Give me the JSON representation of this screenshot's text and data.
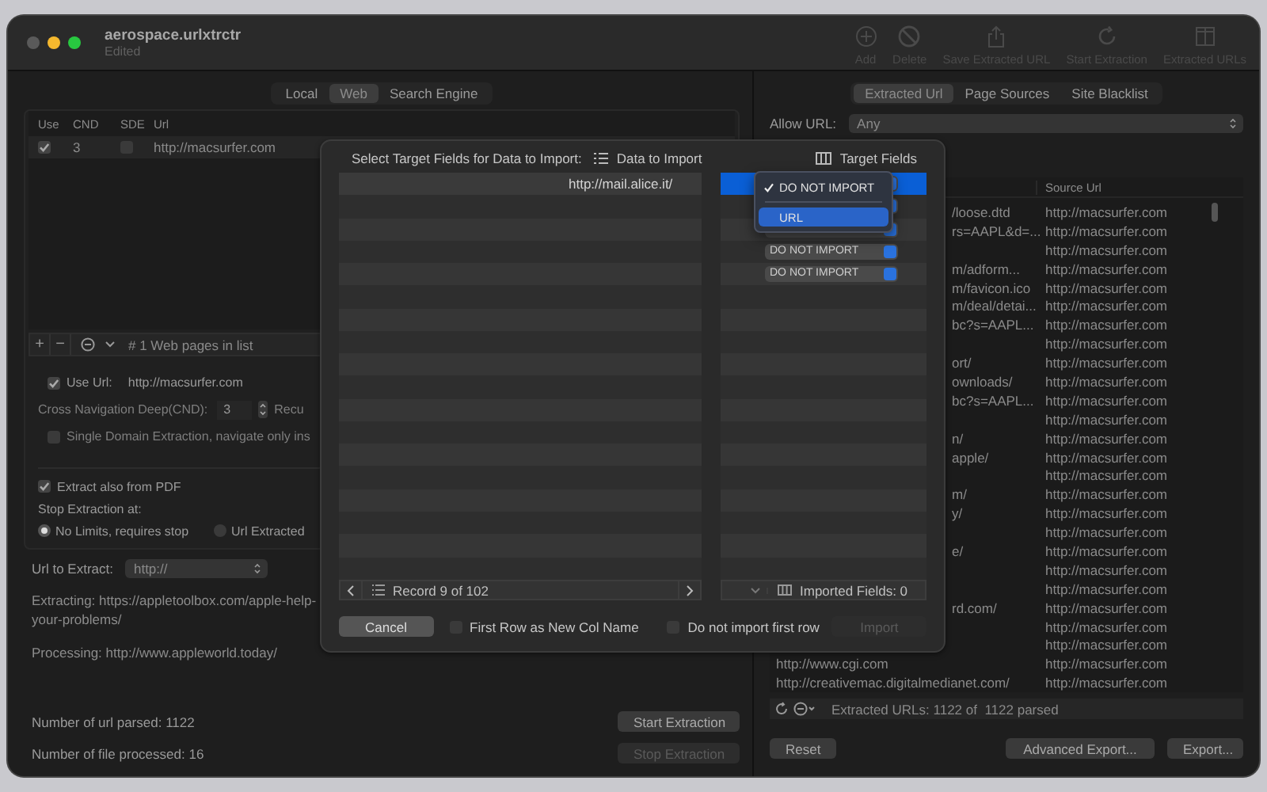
{
  "window": {
    "title": "aerospace.urlxtrctr",
    "subtitle": "Edited"
  },
  "toolbar": [
    {
      "label": "Add",
      "kind": "add",
      "disabled": true
    },
    {
      "label": "Delete",
      "kind": "delete",
      "disabled": true
    },
    {
      "label": "Save Extracted URL",
      "kind": "share",
      "disabled": true
    },
    {
      "label": "Start Extraction",
      "kind": "refresh",
      "disabled": true
    },
    {
      "label": "Extracted URLs",
      "kind": "columns",
      "disabled": true
    }
  ],
  "left_tabs": [
    {
      "label": "Local",
      "selected": false
    },
    {
      "label": "Web",
      "selected": true
    },
    {
      "label": "Search Engine",
      "selected": false
    }
  ],
  "web_table": {
    "columns": [
      "Use",
      "CND",
      "SDE",
      "Url"
    ],
    "rows": [
      {
        "use": true,
        "cnd": "3",
        "sde": false,
        "url": "http://macsurfer.com"
      }
    ]
  },
  "list_bar": {
    "add": "+",
    "remove": "−",
    "count": "# 1 Web pages in list"
  },
  "use_url": {
    "checked": true,
    "label": "Use Url:",
    "value": "http://macsurfer.com"
  },
  "cnd": {
    "label": "Cross Navigation Deep(CND):",
    "value": "3",
    "after": "Recu"
  },
  "single_domain": {
    "checked": false,
    "label": "Single Domain Extraction, navigate only ins"
  },
  "extract_pdf": {
    "checked": true,
    "label": "Extract also from PDF"
  },
  "stop_label": "Stop Extraction at:",
  "stop_options": [
    {
      "label": "No Limits, requires stop",
      "selected": true
    },
    {
      "label": "Url Extracted",
      "selected": false
    }
  ],
  "url_to_extract": {
    "label": "Url to Extract:",
    "value": "http://"
  },
  "extracting": [
    "Extracting: https://appletoolbox.com/apple-help-",
    "your-problems/"
  ],
  "processing": "Processing: http://www.appleworld.today/",
  "url_parsed": "Number of url parsed: 1122",
  "files_processed": "Number of file processed: 16",
  "extraction_buttons": [
    {
      "label": "Start Extraction",
      "disabled": false
    },
    {
      "label": "Stop Extraction",
      "disabled": true
    }
  ],
  "right_tabs": [
    {
      "label": "Extracted Url",
      "selected": true
    },
    {
      "label": "Page Sources",
      "selected": false
    },
    {
      "label": "Site Blacklist",
      "selected": false
    }
  ],
  "allow_url": {
    "label": "Allow URL:",
    "value": "Any"
  },
  "url_table": {
    "source_header": "Source Url",
    "rows_under_sheet": [
      {
        "column_1": "/loose.dtd",
        "source": "http://macsurfer.com"
      },
      {
        "column_1": "rs=AAPL&d=...",
        "source": "http://macsurfer.com"
      },
      {
        "source": "http://macsurfer.com"
      },
      {
        "column_1": "m/adform...",
        "source": "http://macsurfer.com"
      },
      {
        "column_1": "m/favicon.ico",
        "source": "http://macsurfer.com"
      },
      {
        "column_1": "m/deal/detai...",
        "source": "http://macsurfer.com"
      },
      {
        "column_1": "bc?s=AAPL...",
        "source": "http://macsurfer.com"
      },
      {
        "source": "http://macsurfer.com"
      },
      {
        "column_1": "ort/",
        "source": "http://macsurfer.com"
      },
      {
        "column_1": "ownloads/",
        "source": "http://macsurfer.com"
      },
      {
        "column_1": "bc?s=AAPL...",
        "source": "http://macsurfer.com"
      },
      {
        "source": "http://macsurfer.com"
      },
      {
        "column_1": "n/",
        "source": "http://macsurfer.com"
      },
      {
        "column_1": "apple/",
        "source": "http://macsurfer.com"
      },
      {
        "source": "http://macsurfer.com"
      },
      {
        "column_1": "m/",
        "source": "http://macsurfer.com"
      },
      {
        "column_1": "y/",
        "source": "http://macsurfer.com"
      },
      {
        "source": "http://macsurfer.com"
      },
      {
        "column_1": "e/",
        "source": "http://macsurfer.com"
      },
      {
        "source": "http://macsurfer.com"
      },
      {
        "source": "http://macsurfer.com"
      },
      {
        "column_1": "rd.com/",
        "source": "http://macsurfer.com"
      },
      {
        "source": "http://macsurfer.com"
      },
      {
        "source": "http://macsurfer.com"
      }
    ],
    "rows": [
      {
        "column_1": "http://www.cgi.com",
        "source": "http://macsurfer.com"
      },
      {
        "column_1": "http://creativemac.digitalmedianet.com/",
        "source": "http://macsurfer.com"
      }
    ]
  },
  "status": "Extracted URLs: 1122 of  1122 parsed",
  "bottom_buttons": [
    "Reset",
    "Advanced Export...",
    "Export..."
  ],
  "import_sheet": {
    "title": "Select Target Fields for Data to Import:",
    "data_header": "Data to Import",
    "target_header": "Target Fields",
    "data_rows": [
      "http://mail.alice.it/"
    ],
    "target_rows": [
      {
        "selected": true
      },
      {
        "selected": false
      },
      {
        "selected": false
      },
      {
        "selected": false,
        "field": "DO NOT IMPORT"
      },
      {
        "selected": false,
        "field": "DO NOT IMPORT"
      }
    ],
    "menu": [
      {
        "label": "DO NOT IMPORT",
        "checked": true,
        "highlighted": false
      },
      {
        "label": "URL",
        "checked": false,
        "highlighted": true
      }
    ],
    "record": "Record 9 of 102",
    "imported": "Imported Fields: 0",
    "cancel": "Cancel",
    "options": [
      {
        "label": "First Row as New Col Name",
        "checked": false
      },
      {
        "label": "Do not import first row",
        "checked": false
      }
    ],
    "import": {
      "label": "Import",
      "disabled": true
    }
  }
}
